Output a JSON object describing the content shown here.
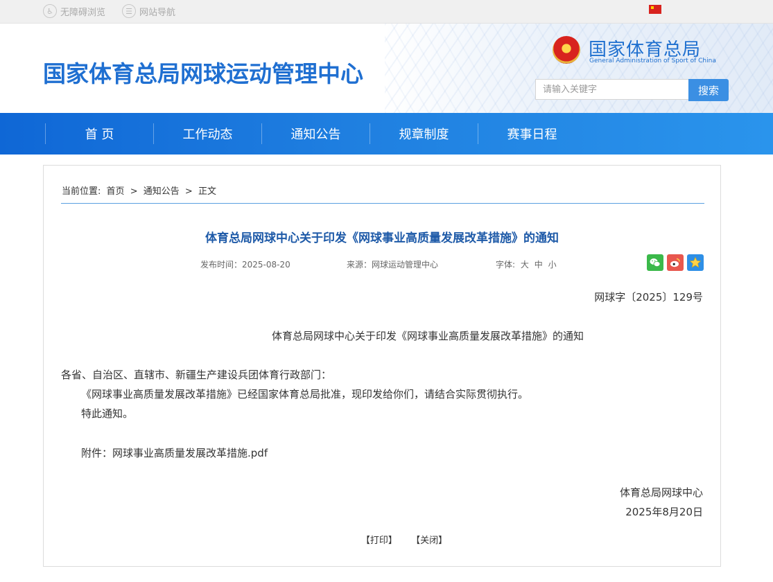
{
  "topbar": {
    "accessibility_label": "无障碍浏览",
    "sitemap_label": "网站导航"
  },
  "header": {
    "site_title": "国家体育总局网球运动管理中心",
    "agency_name_cn": "国家体育总局",
    "agency_name_en": "General Administration of Sport of China",
    "search_placeholder": "请输入关键字",
    "search_button": "搜索"
  },
  "nav": {
    "items": [
      {
        "label": "首 页"
      },
      {
        "label": "工作动态"
      },
      {
        "label": "通知公告"
      },
      {
        "label": "规章制度"
      },
      {
        "label": "赛事日程"
      }
    ]
  },
  "breadcrumb": {
    "prefix": "当前位置:",
    "items": [
      "首页",
      ">",
      "通知公告",
      ">",
      "正文"
    ]
  },
  "article": {
    "title": "体育总局网球中心关于印发《网球事业高质量发展改革措施》的通知",
    "publish_time": "发布时间：2025-08-20",
    "source": "来源：网球运动管理中心",
    "font_size_label": "字体:",
    "font_sizes": [
      "大",
      "中",
      "小"
    ],
    "share": {
      "wechat_icon": "wechat-icon",
      "weibo_icon": "weibo-icon",
      "favorite_icon": "star-icon"
    },
    "doc_number": "网球字〔2025〕129号",
    "doc_title": "体育总局网球中心关于印发《网球事业高质量发展改革措施》的通知",
    "addressee": "各省、自治区、直辖市、新疆生产建设兵团体育行政部门：",
    "paragraph1": "《网球事业高质量发展改革措施》已经国家体育总局批准，现印发给你们，请结合实际贯彻执行。",
    "paragraph2": "特此通知。",
    "attachment_label": "附件：",
    "attachment_link": "网球事业高质量发展改革措施.pdf",
    "signature_org": "体育总局网球中心",
    "signature_date": "2025年8月20日",
    "print_button": "【打印】",
    "close_button": "【关闭】"
  },
  "colors": {
    "brand_blue": "#1f6fd1",
    "nav_blue": "#1a78dd",
    "title_blue": "#1e5aa8"
  }
}
